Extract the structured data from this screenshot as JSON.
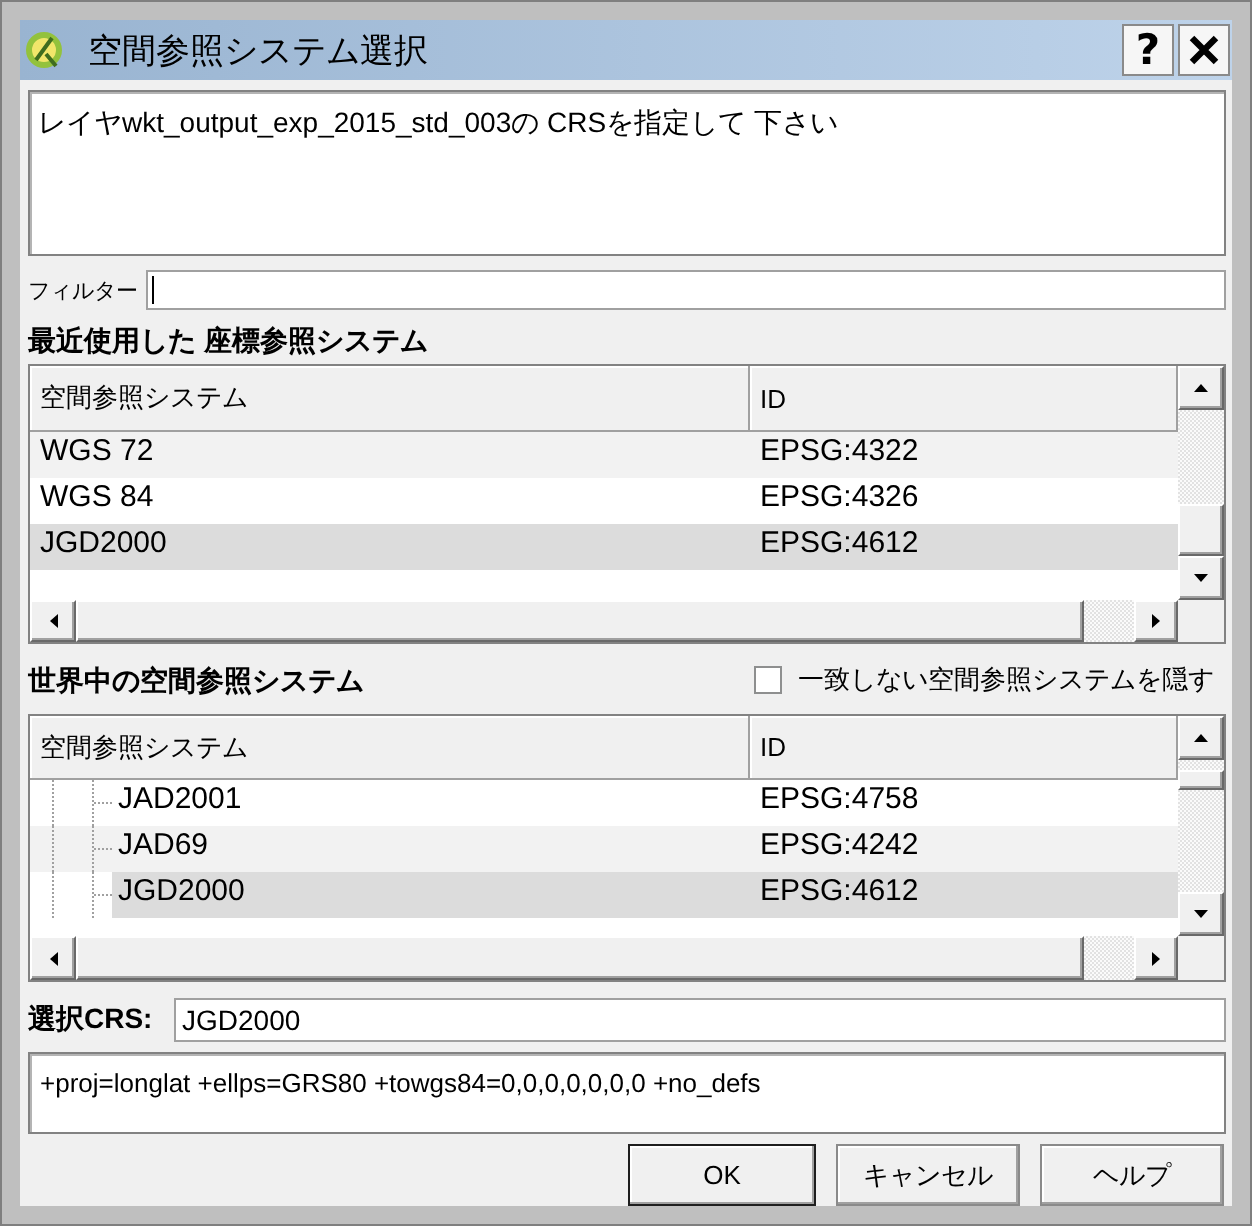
{
  "window": {
    "title": "空間参照システム選択",
    "help_button": "?"
  },
  "message": "レイヤwkt_output_exp_2015_std_003の CRSを指定して 下さい",
  "filter": {
    "label": "フィルター",
    "focused": true
  },
  "recent": {
    "title": "最近使用した 座標参照システム",
    "columns": [
      "空間参照システム",
      "ID"
    ],
    "rows": [
      {
        "name": "WGS 72",
        "id": "EPSG:4322",
        "selected": false
      },
      {
        "name": "WGS 84",
        "id": "EPSG:4326",
        "selected": false
      },
      {
        "name": "JGD2000",
        "id": "EPSG:4612",
        "selected": true
      }
    ]
  },
  "world": {
    "title": "世界中の空間参照システム",
    "hide_unmatched": {
      "label": "一致しない空間参照システムを隠す",
      "checked": false
    },
    "columns": [
      "空間参照システム",
      "ID"
    ],
    "rows": [
      {
        "name": "JAD2001",
        "id": "EPSG:4758",
        "selected": false
      },
      {
        "name": "JAD69",
        "id": "EPSG:4242",
        "selected": false
      },
      {
        "name": "JGD2000",
        "id": "EPSG:4612",
        "selected": true
      }
    ]
  },
  "selected_crs": {
    "label": "選択CRS:",
    "value": "JGD2000"
  },
  "proj": "+proj=longlat +ellps=GRS80 +towgs84=0,0,0,0,0,0,0 +no_defs",
  "buttons": [
    {
      "label": "OK",
      "default": true
    },
    {
      "label": "キャンセル",
      "default": false
    },
    {
      "label": "ヘルプ",
      "default": false
    }
  ]
}
